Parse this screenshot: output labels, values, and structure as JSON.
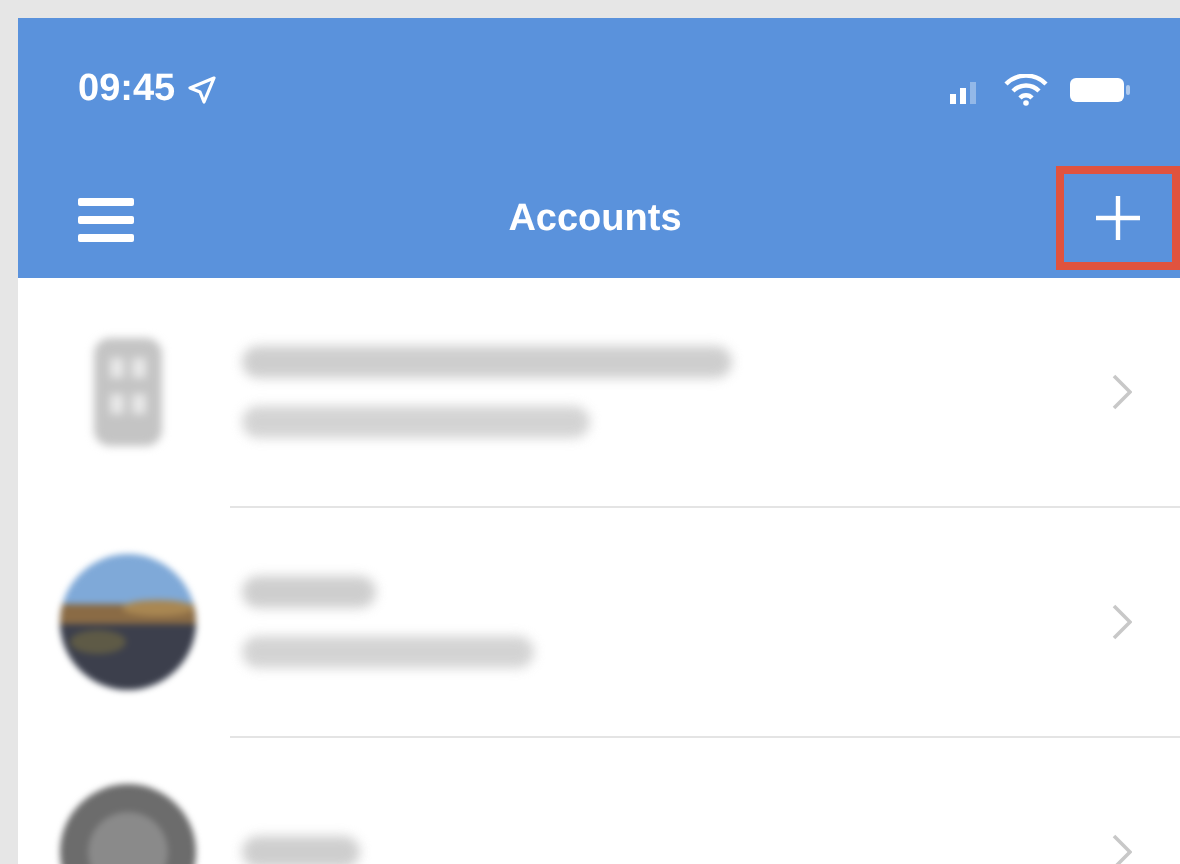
{
  "status_bar": {
    "time": "09:45",
    "location_on": true
  },
  "nav_bar": {
    "title": "Accounts",
    "add_button": {
      "highlighted": true
    }
  },
  "accounts": [
    {
      "kind": "building",
      "subtitle_visible": true
    },
    {
      "kind": "picture",
      "subtitle_visible": true
    },
    {
      "kind": "gray",
      "subtitle_visible": false
    }
  ]
}
